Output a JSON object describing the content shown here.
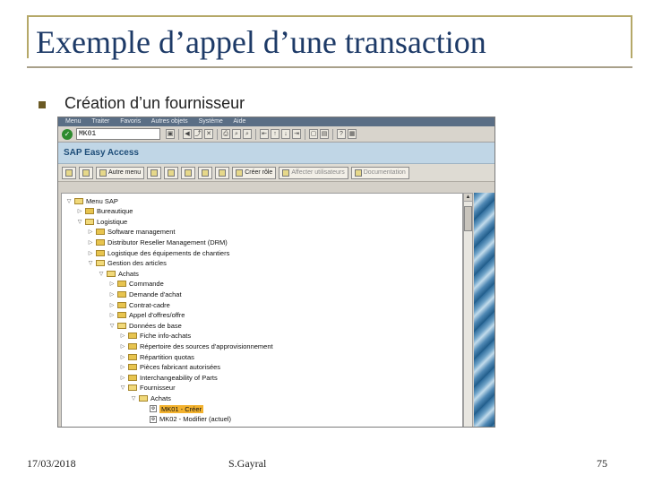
{
  "slide": {
    "title": "Exemple d’appel d’une transaction",
    "bullet": "Création d’un fournisseur",
    "footer_date": "17/03/2018",
    "footer_author": "S.Gayral",
    "page_number": "75",
    "colors": {
      "title": "#1d3a67",
      "frame": "#b5a868",
      "bullet": "#6b5a24"
    }
  },
  "sap": {
    "menubar": [
      "Menu",
      "Traiter",
      "Favoris",
      "Autres objets",
      "Système",
      "Aide"
    ],
    "command_field_value": "MK01",
    "screen_title": "SAP Easy Access",
    "app_toolbar": {
      "other_menu_label": "Autre menu",
      "create_role_label": "Créer rôle",
      "assign_users_label": "Affecter utilisateurs",
      "documentation_label": "Documentation"
    },
    "tree": [
      {
        "label": "Menu SAP",
        "depth": 0,
        "kind": "folder",
        "open": true
      },
      {
        "label": "Bureautique",
        "depth": 1,
        "kind": "folder",
        "open": false
      },
      {
        "label": "Logistique",
        "depth": 1,
        "kind": "folder",
        "open": true
      },
      {
        "label": "Software management",
        "depth": 2,
        "kind": "folder",
        "open": false
      },
      {
        "label": "Distributor Reseller Management (DRM)",
        "depth": 2,
        "kind": "folder",
        "open": false
      },
      {
        "label": "Logistique des équipements de chantiers",
        "depth": 2,
        "kind": "folder",
        "open": false
      },
      {
        "label": "Gestion des articles",
        "depth": 2,
        "kind": "folder",
        "open": true
      },
      {
        "label": "Achats",
        "depth": 3,
        "kind": "folder",
        "open": true
      },
      {
        "label": "Commande",
        "depth": 4,
        "kind": "folder",
        "open": false
      },
      {
        "label": "Demande d'achat",
        "depth": 4,
        "kind": "folder",
        "open": false
      },
      {
        "label": "Contrat-cadre",
        "depth": 4,
        "kind": "folder",
        "open": false
      },
      {
        "label": "Appel d'offres/offre",
        "depth": 4,
        "kind": "folder",
        "open": false
      },
      {
        "label": "Données de base",
        "depth": 4,
        "kind": "folder",
        "open": true
      },
      {
        "label": "Fiche info-achats",
        "depth": 5,
        "kind": "folder",
        "open": false
      },
      {
        "label": "Répertoire des sources d'approvisionnement",
        "depth": 5,
        "kind": "folder",
        "open": false
      },
      {
        "label": "Répartition quotas",
        "depth": 5,
        "kind": "folder",
        "open": false
      },
      {
        "label": "Pièces fabricant autorisées",
        "depth": 5,
        "kind": "folder",
        "open": false
      },
      {
        "label": "Interchangeability of Parts",
        "depth": 5,
        "kind": "folder",
        "open": false
      },
      {
        "label": "Fournisseur",
        "depth": 5,
        "kind": "folder",
        "open": true
      },
      {
        "label": "Achats",
        "depth": 6,
        "kind": "folder",
        "open": true
      },
      {
        "label": "MK01 - Créer",
        "depth": 7,
        "kind": "transaction",
        "selected": true
      },
      {
        "label": "MK02 - Modifier (actuel)",
        "depth": 7,
        "kind": "transaction",
        "selected": false
      }
    ]
  }
}
